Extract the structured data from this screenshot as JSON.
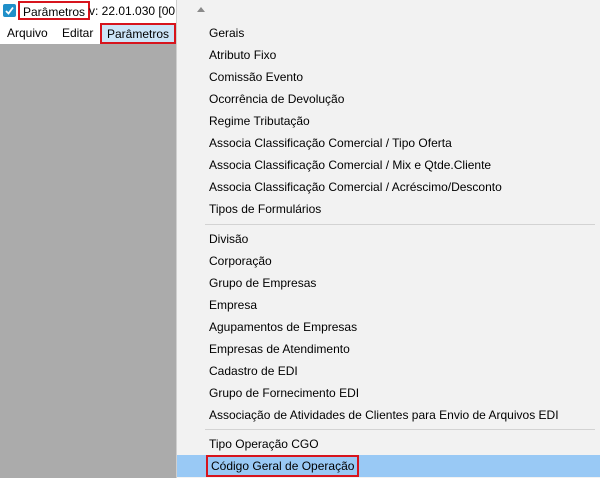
{
  "window": {
    "title": "Parâmetros",
    "version": "v: 22.01.030  [00"
  },
  "menubar": {
    "items": [
      "Arquivo",
      "Editar",
      "Parâmetros"
    ]
  },
  "dropdown": {
    "group1": [
      "Gerais",
      "Atributo Fixo",
      "Comissão Evento",
      "Ocorrência de Devolução",
      "Regime Tributação",
      "Associa Classificação Comercial / Tipo Oferta",
      "Associa Classificação Comercial / Mix e Qtde.Cliente",
      "Associa Classificação Comercial / Acréscimo/Desconto",
      "Tipos de Formulários"
    ],
    "group2": [
      "Divisão",
      "Corporação",
      "Grupo de Empresas",
      "Empresa",
      "Agupamentos de Empresas",
      "Empresas de Atendimento",
      "Cadastro de EDI",
      "Grupo de Fornecimento EDI",
      "Associação de Atividades de Clientes para Envio de Arquivos EDI"
    ],
    "group3": [
      "Tipo Operação CGO",
      "Código Geral de Operação"
    ]
  },
  "colors": {
    "highlight_border": "#d7141d",
    "selected_bg": "#99c9f5",
    "workspace_bg": "#ababab",
    "menu_bg": "#f2f2f2"
  }
}
